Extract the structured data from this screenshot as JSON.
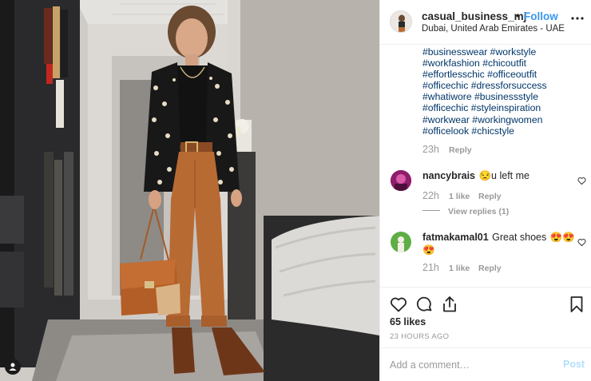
{
  "post": {
    "username": "casual_business_mj",
    "dot": "•",
    "follow_label": "Follow",
    "location": "Dubai, United Arab Emirates - UAE"
  },
  "caption": {
    "hashtag_lines": [
      "#businesswear #workstyle",
      "#workfashion #chicoutfit",
      "#effortlesschic #officeoutfit",
      "#officechic #dressforsuccess",
      "#whatiwore #businessstyle",
      "#officechic #styleinspiration",
      "#workwear #workingwomen",
      "#officelook #chicstyle"
    ],
    "time": "23h",
    "reply_label": "Reply"
  },
  "comments": [
    {
      "username": "nancybrais",
      "text": "u left me",
      "emoji": "😒",
      "time": "22h",
      "likes": "1 like",
      "reply_label": "Reply",
      "view_replies": "View replies (1)"
    },
    {
      "username": "fatmakamal01",
      "text": "Great shoes",
      "emoji": "😍😍😍",
      "time": "21h",
      "likes": "1 like",
      "reply_label": "Reply"
    }
  ],
  "actions": {
    "likes": "65 likes",
    "timestamp": "23 HOURS AGO"
  },
  "comment_box": {
    "placeholder": "Add a comment…",
    "post_label": "Post"
  },
  "colors": {
    "follow": "#3897f0",
    "hashtag": "#003569",
    "post_disabled": "#b2dffc",
    "meta": "#999999"
  },
  "icons": [
    "more-icon",
    "heart-icon",
    "comment-icon",
    "share-icon",
    "bookmark-icon",
    "user-tag-icon"
  ]
}
